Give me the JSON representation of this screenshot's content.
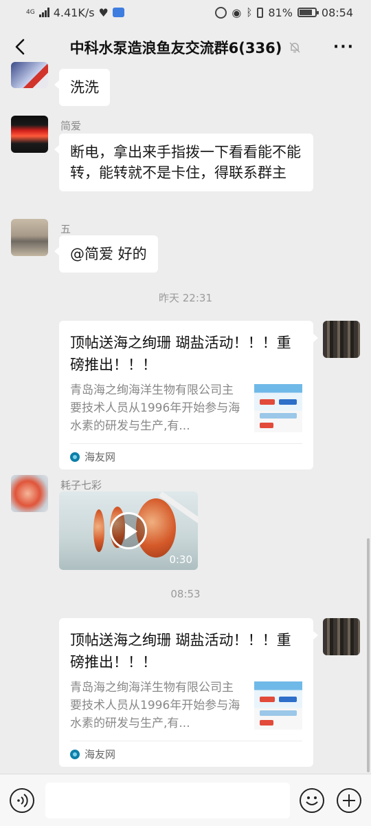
{
  "status_bar": {
    "network_type": "4G",
    "speed": "4.41K/s",
    "battery_percent": "81%",
    "battery_level": 0.81,
    "time": "08:54"
  },
  "header": {
    "title": "中科水泵造浪鱼友交流群6(336)",
    "back_icon": "chevron-left-icon",
    "mute_icon": "bell-off-icon",
    "more_icon": "more-dots-icon"
  },
  "messages": [
    {
      "type": "text",
      "sender": "",
      "text": "洗洗"
    },
    {
      "type": "text",
      "sender": "简爱",
      "text": "断电，拿出来手指拨一下看看能不能转，能转就不是卡住，得联系群主"
    },
    {
      "type": "text",
      "sender": "五",
      "text": "@简爱  好的"
    },
    {
      "type": "time",
      "text": "昨天 22:31"
    },
    {
      "type": "link_card",
      "title": "顶帖送海之绚珊 瑚盐活动！！！重磅推出！！！",
      "desc": "青岛海之绚海洋生物有限公司主要技术人员从1996年开始参与海水素的研发与生产,有...",
      "source": "海友网"
    },
    {
      "type": "video",
      "sender": "耗子七彩",
      "duration": "0:30"
    },
    {
      "type": "time",
      "text": "08:53"
    },
    {
      "type": "link_card",
      "title": "顶帖送海之绚珊 瑚盐活动！！！重磅推出！！！",
      "desc": "青岛海之绚海洋生物有限公司主要技术人员从1996年开始参与海水素的研发与生产,有...",
      "source": "海友网"
    }
  ],
  "input_bar": {
    "voice_icon": "voice-icon",
    "emoji_icon": "emoji-icon",
    "plus_icon": "plus-icon",
    "text_value": ""
  }
}
